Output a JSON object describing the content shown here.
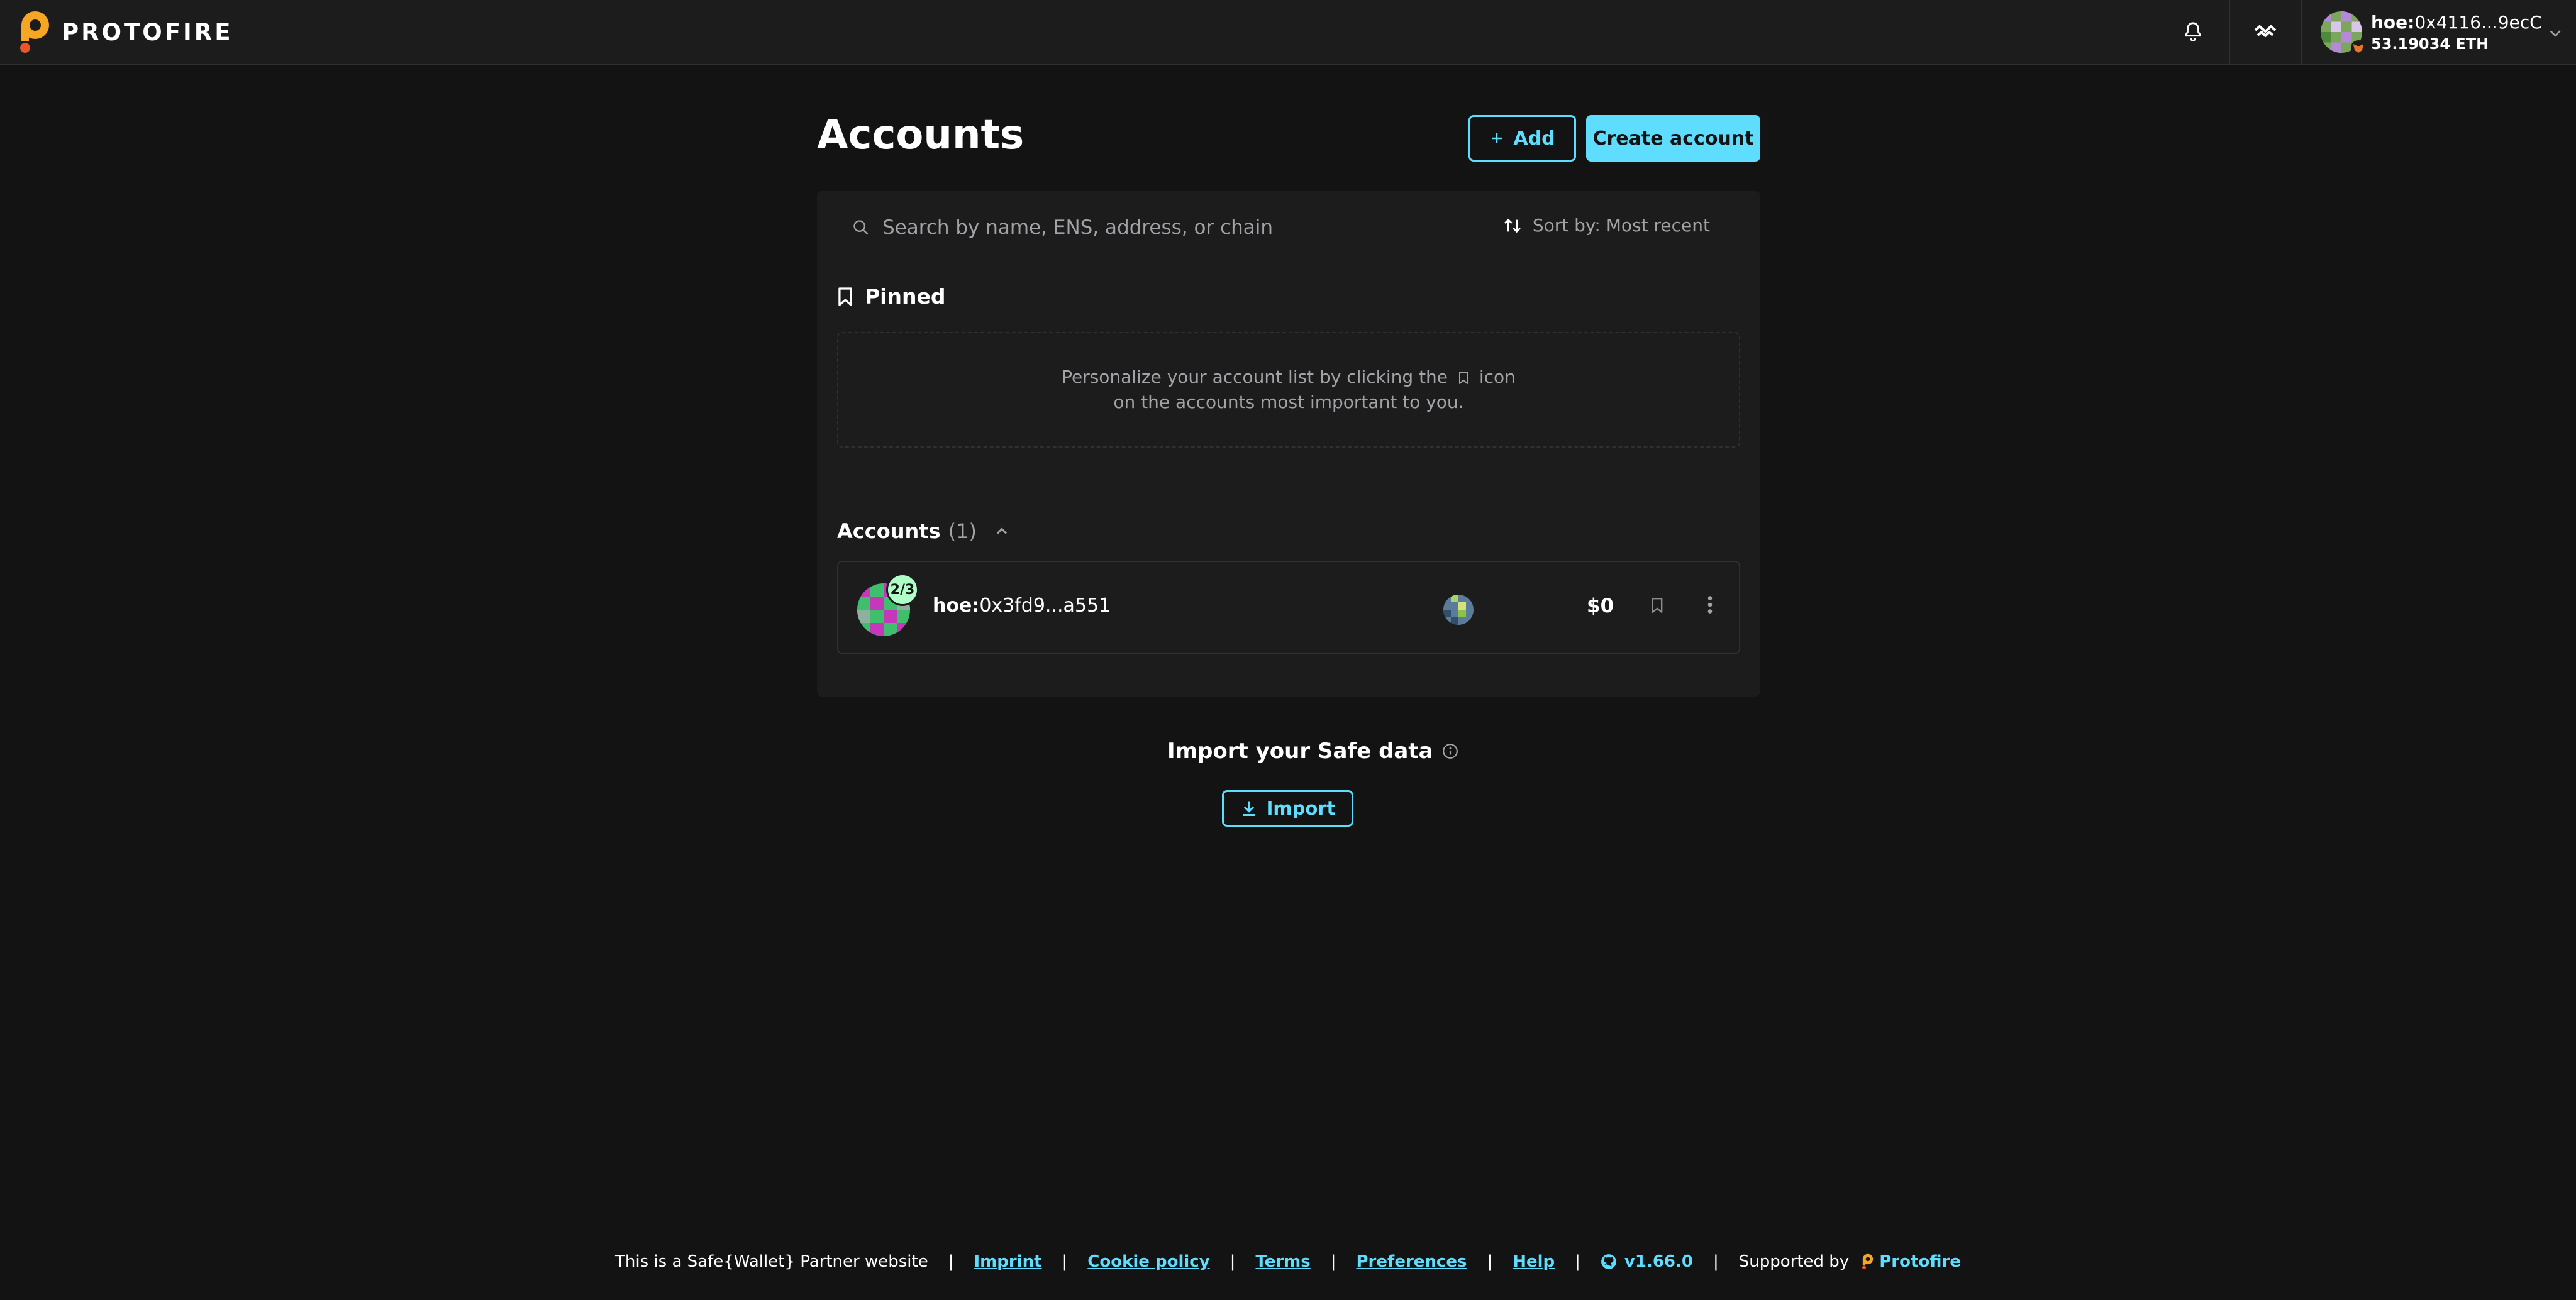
{
  "header": {
    "brand_name": "PROTOFIRE",
    "account": {
      "prefix": "hoe:",
      "address": "0x4116...9ecC",
      "balance": "53.19034 ETH"
    },
    "icons": [
      "bell-icon",
      "walletconnect-icon",
      "chevron-down-icon"
    ]
  },
  "main": {
    "title": "Accounts",
    "add_button": "Add",
    "create_button": "Create account",
    "search": {
      "placeholder": "Search by name, ENS, address, or chain",
      "sort_label": "Sort by: Most recent"
    },
    "pinned": {
      "heading": "Pinned",
      "empty_line1_a": "Personalize your account list by clicking the",
      "empty_line1_b": "icon",
      "empty_line2": "on the accounts most important to you."
    },
    "accounts": {
      "heading": "Accounts",
      "count": "(1)",
      "items": [
        {
          "threshold": "2/3",
          "prefix": "hoe:",
          "address": "0x3fd9...a551",
          "balance": "$0"
        }
      ]
    },
    "import": {
      "title": "Import your Safe data",
      "button": "Import"
    }
  },
  "footer": {
    "partner_text": "This is a Safe{Wallet} Partner website",
    "links": [
      "Imprint",
      "Cookie policy",
      "Terms",
      "Preferences",
      "Help"
    ],
    "separator": "|",
    "version": "v1.66.0",
    "supported_by": "Supported by",
    "supporter": "Protofire"
  },
  "colors": {
    "background": "#121312",
    "panel": "#1c1c1c",
    "accent": "#5fddff",
    "muted_text": "#a1a3a7",
    "border": "#303033",
    "brand_orange": "#f5a623"
  }
}
